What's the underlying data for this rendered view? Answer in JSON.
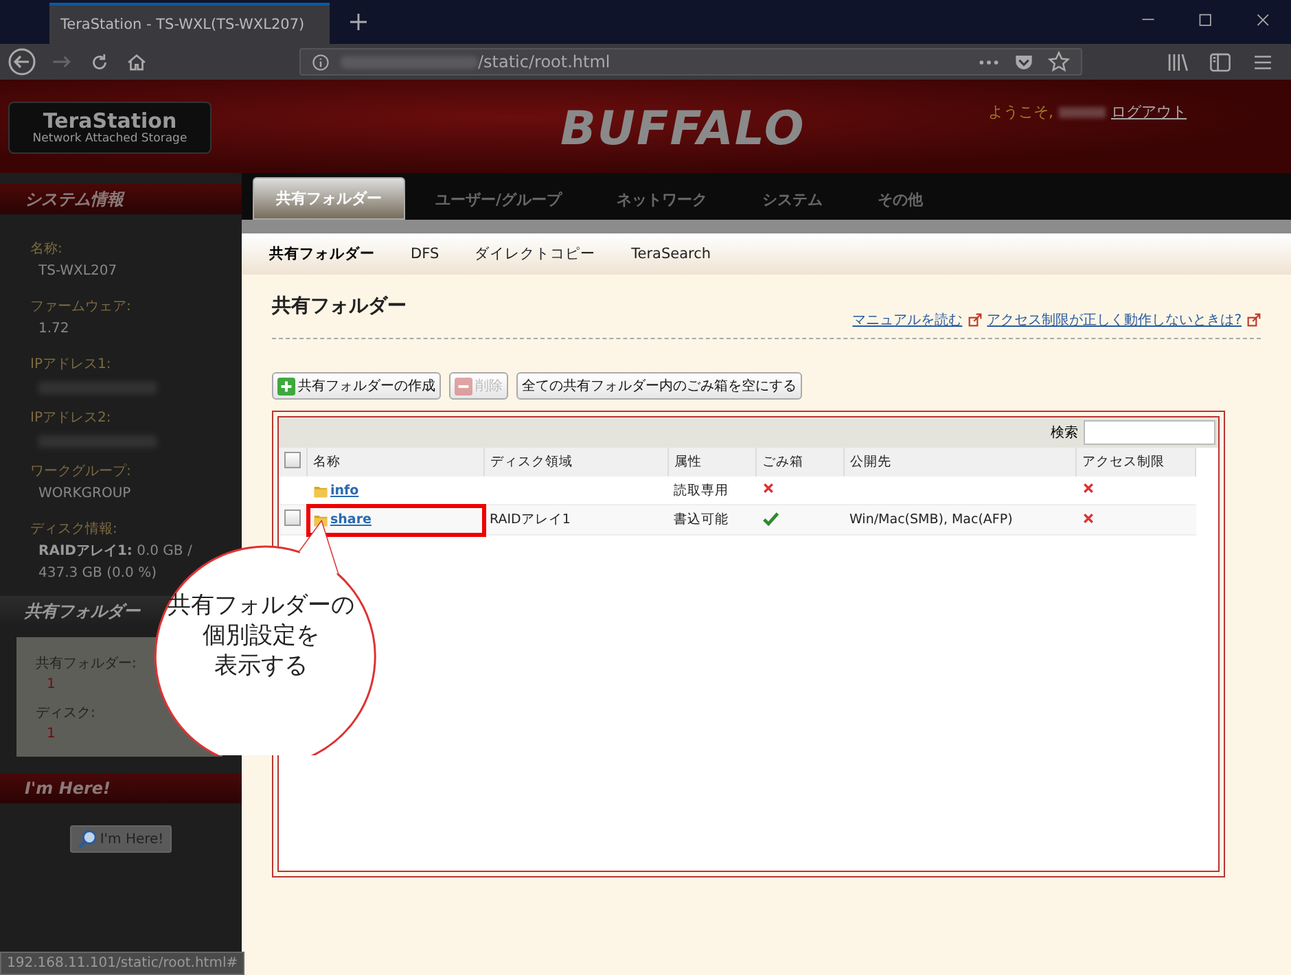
{
  "browser": {
    "tab_title": "TeraStation - TS-WXL(TS-WXL207)",
    "url": "/static/root.html",
    "status_url": "192.168.11.101/static/root.html#"
  },
  "header": {
    "logo_title": "TeraStation",
    "logo_subtitle": "Network Attached Storage",
    "brand": "BUFFALO",
    "welcome": "ようこそ,",
    "logout": "ログアウト"
  },
  "sidebar": {
    "system_title": "システム情報",
    "info": [
      {
        "label": "名称:",
        "value": "TS-WXL207"
      },
      {
        "label": "ファームウェア:",
        "value": "1.72"
      },
      {
        "label": "IPアドレス1:"
      },
      {
        "label": "IPアドレス2:"
      },
      {
        "label": "ワークグループ:",
        "value": "WORKGROUP"
      },
      {
        "label": "ディスク情報:",
        "value": "**RAIDアレイ1:** 0.0 GB / 437.3 GB (0.0 %)"
      }
    ],
    "shared_title": "共有フォルダー",
    "shared": [
      {
        "label": "共有フォルダー:",
        "value": "1"
      },
      {
        "label": "ディスク:",
        "value": "1"
      }
    ],
    "imhere_title": "I'm Here!",
    "imhere_button": "I'm Here!"
  },
  "nav": {
    "tabs": [
      {
        "label": "共有フォルダー",
        "selected": true
      },
      {
        "label": "ユーザー/グループ",
        "selected": false
      },
      {
        "label": "ネットワーク",
        "selected": false
      },
      {
        "label": "システム",
        "selected": false
      },
      {
        "label": "その他",
        "selected": false
      }
    ],
    "subtabs": [
      {
        "label": "共有フォルダー",
        "selected": true
      },
      {
        "label": "DFS",
        "selected": false
      },
      {
        "label": "ダイレクトコピー",
        "selected": false
      },
      {
        "label": "TeraSearch",
        "selected": false
      }
    ]
  },
  "page": {
    "title": "共有フォルダー",
    "links": [
      "マニュアルを読む",
      "アクセス制限が正しく動作しないときは?"
    ],
    "buttons": [
      {
        "label": "共有フォルダーの作成",
        "kind": "add",
        "disabled": false
      },
      {
        "label": "削除",
        "kind": "remove",
        "disabled": true
      },
      {
        "label": "全ての共有フォルダー内のごみ箱を空にする",
        "kind": "plain",
        "disabled": false
      }
    ],
    "search_label": "検索",
    "table": {
      "select_all": {
        "checked": false
      },
      "columns": [
        "名称",
        "ディスク領域",
        "属性",
        "ごみ箱",
        "公開先",
        "アクセス制限"
      ],
      "rows": [
        {
          "name": "info",
          "attribute": "読取専用",
          "trash": false,
          "access_limit": false,
          "kind": "system",
          "highlighted": false
        },
        {
          "name": "share",
          "disk": "RAIDアレイ1",
          "attribute": "書込可能",
          "trash": true,
          "publish": "Win/Mac(SMB), Mac(AFP)",
          "access_limit": false,
          "kind": "user",
          "checked": false,
          "highlighted": true
        }
      ]
    }
  },
  "callout": {
    "lines": [
      "共有フォルダーの",
      "個別設定を",
      "表示する"
    ]
  }
}
